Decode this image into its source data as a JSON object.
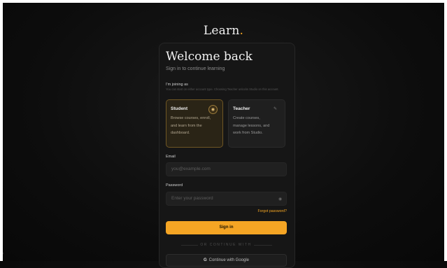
{
  "brand": {
    "name": "Learn",
    "dot": "."
  },
  "heading": {
    "title": "Welcome back",
    "subtitle": "Sign in to continue learning"
  },
  "role_selection": {
    "label": "I'm joining as",
    "hint": "You can start on either account type. Choosing Teacher unlocks Studio on this account.",
    "options": [
      {
        "title": "Student",
        "description": "Browse courses, enroll, and learn from the dashboard.",
        "icon": "graduation-cap-icon",
        "selected": true
      },
      {
        "title": "Teacher",
        "description": "Create courses, manage lessons, and work from Studio.",
        "icon": "pencil-icon",
        "selected": false
      }
    ]
  },
  "form": {
    "email_label": "Email",
    "email_placeholder": "you@example.com",
    "password_label": "Password",
    "password_placeholder": "Enter your password",
    "password_icon": "eye-icon",
    "forgot_password": "Forgot password?",
    "submit_label": "Sign in"
  },
  "divider": {
    "text": "OR CONTINUE WITH"
  },
  "social": {
    "google_label": "Continue with Google",
    "icon": "google-icon"
  },
  "page_indicator": "0",
  "colors": {
    "accent": "#f5a524",
    "background": "#0d0d0d",
    "card": "#161616"
  }
}
